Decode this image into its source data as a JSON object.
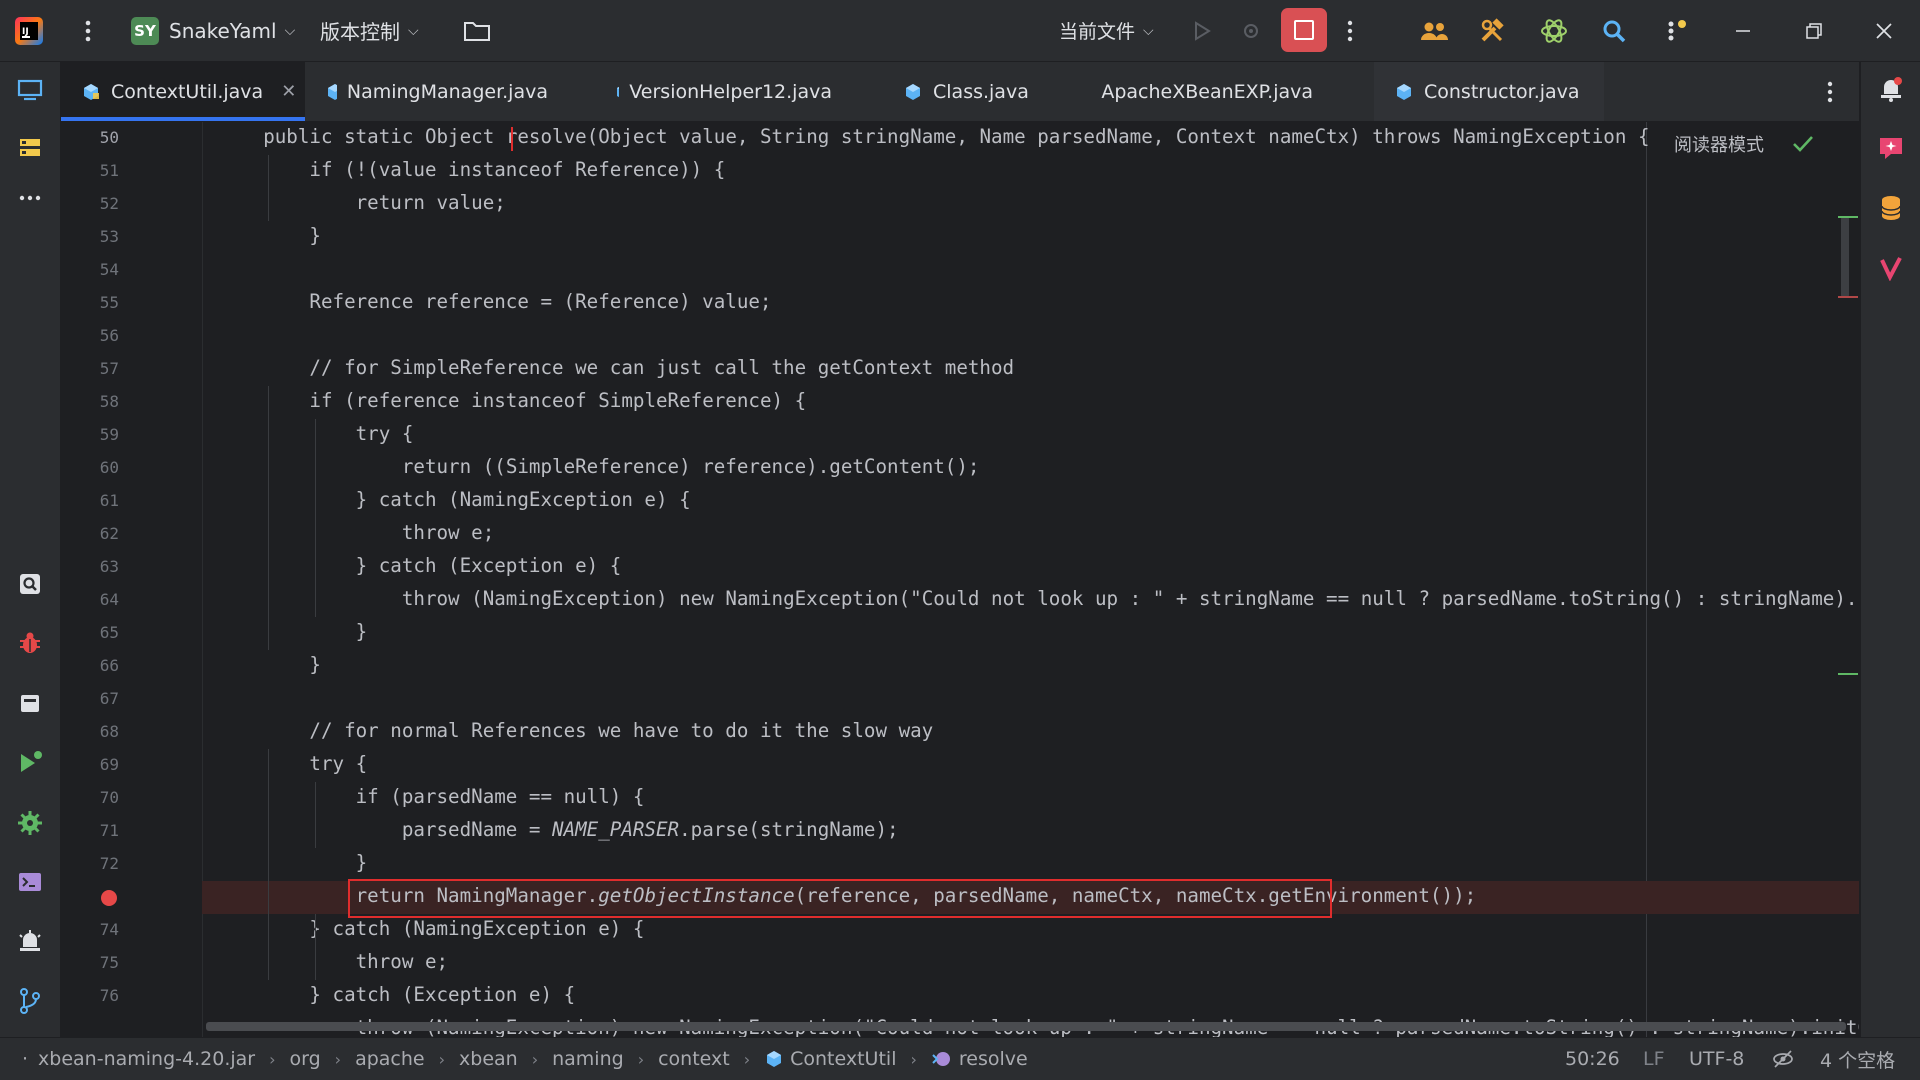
{
  "toolbar": {
    "project_initials": "SY",
    "project_name": "SnakeYaml",
    "vcs_label": "版本控制",
    "run_config": "当前文件"
  },
  "tabs": [
    {
      "label": "ContextUtil.java",
      "active": true,
      "icon": "java-class-icon"
    },
    {
      "label": "NamingManager.java",
      "active": false,
      "icon": "java-class-icon"
    },
    {
      "label": "VersionHelper12.java",
      "active": false,
      "icon": "java-class-icon"
    },
    {
      "label": "Class.java",
      "active": false,
      "icon": "java-class-icon"
    },
    {
      "label": "ApacheXBeanEXP.java",
      "active": false,
      "icon": "java-class-icon"
    },
    {
      "label": "Constructor.java",
      "active": false,
      "icon": "java-class-icon"
    }
  ],
  "editor": {
    "reader_mode_label": "阅读器模式",
    "line_numbers": [
      "50",
      "51",
      "52",
      "53",
      "54",
      "55",
      "56",
      "57",
      "58",
      "59",
      "60",
      "61",
      "62",
      "63",
      "64",
      "65",
      "66",
      "67",
      "68",
      "69",
      "70",
      "71",
      "72",
      "",
      "74",
      "75",
      "76"
    ],
    "breakpoint_line": "73",
    "lines": [
      [
        [
          "    public ",
          "kw"
        ],
        [
          "static ",
          "kw"
        ],
        [
          "Object ",
          ""
        ],
        [
          "resolve",
          "fn"
        ],
        [
          "(Object value, String stringName, Name parsedName, Context nameCtx) ",
          ""
        ],
        [
          "throws ",
          "kw"
        ],
        [
          "NamingException {",
          ""
        ]
      ],
      [
        [
          "        ",
          ""
        ],
        [
          "if ",
          "kw"
        ],
        [
          "(!(value ",
          ""
        ],
        [
          "instanceof ",
          "kw"
        ],
        [
          "Reference)) {",
          ""
        ]
      ],
      [
        [
          "            ",
          ""
        ],
        [
          "return ",
          "kw"
        ],
        [
          "value;",
          ""
        ]
      ],
      [
        [
          "        }",
          ""
        ]
      ],
      [
        [
          "",
          ""
        ]
      ],
      [
        [
          "        Reference reference = (Reference) value;",
          ""
        ]
      ],
      [
        [
          "",
          ""
        ]
      ],
      [
        [
          "        ",
          ""
        ],
        [
          "// for SimpleReference we can just call the getContext method",
          "cm"
        ]
      ],
      [
        [
          "        ",
          ""
        ],
        [
          "if ",
          "kw"
        ],
        [
          "(reference ",
          ""
        ],
        [
          "instanceof ",
          "kw"
        ],
        [
          "SimpleReference) {",
          ""
        ]
      ],
      [
        [
          "            ",
          ""
        ],
        [
          "try ",
          "kw"
        ],
        [
          "{",
          ""
        ]
      ],
      [
        [
          "                ",
          ""
        ],
        [
          "return ",
          "kw"
        ],
        [
          "((SimpleReference) reference).getContent();",
          ""
        ]
      ],
      [
        [
          "            } ",
          ""
        ],
        [
          "catch ",
          "kw"
        ],
        [
          "(NamingException e) {",
          ""
        ]
      ],
      [
        [
          "                ",
          ""
        ],
        [
          "throw ",
          "kw"
        ],
        [
          "e;",
          ""
        ]
      ],
      [
        [
          "            } ",
          ""
        ],
        [
          "catch ",
          "kw"
        ],
        [
          "(Exception e) {",
          ""
        ]
      ],
      [
        [
          "                ",
          ""
        ],
        [
          "throw ",
          "kw"
        ],
        [
          "(NamingException) ",
          ""
        ],
        [
          "new ",
          "kw"
        ],
        [
          "NamingException(",
          ""
        ],
        [
          "\"Could not look up : \" ",
          "str"
        ],
        [
          "+ stringName == ",
          ""
        ],
        [
          "null ",
          "kw"
        ],
        [
          "? parsedName.toString() : stringName).initCause(e);",
          ""
        ]
      ],
      [
        [
          "            }",
          ""
        ]
      ],
      [
        [
          "        }",
          ""
        ]
      ],
      [
        [
          "",
          ""
        ]
      ],
      [
        [
          "        ",
          ""
        ],
        [
          "// for normal References we have to do it the slow way",
          "cm"
        ]
      ],
      [
        [
          "        ",
          ""
        ],
        [
          "try ",
          "kw"
        ],
        [
          "{",
          ""
        ]
      ],
      [
        [
          "            ",
          ""
        ],
        [
          "if ",
          "kw"
        ],
        [
          "(parsedName == ",
          ""
        ],
        [
          "null",
          "kw"
        ],
        [
          ") {",
          ""
        ]
      ],
      [
        [
          "                parsedName = ",
          ""
        ],
        [
          "NAME_PARSER",
          "const"
        ],
        [
          ".parse(stringName);",
          ""
        ]
      ],
      [
        [
          "            }",
          ""
        ]
      ],
      [
        [
          "            ",
          ""
        ],
        [
          "return ",
          "kw"
        ],
        [
          "NamingManager.",
          ""
        ],
        [
          "getObjectInstance",
          "it"
        ],
        [
          "(reference, parsedName, nameCtx, nameCtx.getEnvironment());",
          ""
        ]
      ],
      [
        [
          "        } ",
          ""
        ],
        [
          "catch ",
          "kw"
        ],
        [
          "(NamingException e) {",
          ""
        ]
      ],
      [
        [
          "            ",
          ""
        ],
        [
          "throw ",
          "kw"
        ],
        [
          "e;",
          ""
        ]
      ],
      [
        [
          "        } ",
          ""
        ],
        [
          "catch ",
          "kw"
        ],
        [
          "(Exception e) {",
          ""
        ]
      ],
      [
        [
          "            ",
          ""
        ],
        [
          "throw ",
          "kw"
        ],
        [
          "(NamingException) ",
          ""
        ],
        [
          "new ",
          "kw"
        ],
        [
          "NamingException(",
          ""
        ],
        [
          "\"Could not look up : \" ",
          "str"
        ],
        [
          "+ stringName == ",
          ""
        ],
        [
          "null ",
          "kw"
        ],
        [
          "? parsedName.toString() : stringName).initCause(e);",
          ""
        ]
      ]
    ]
  },
  "breadcrumbs": [
    "xbean-naming-4.20.jar",
    "org",
    "apache",
    "xbean",
    "naming",
    "context",
    "ContextUtil",
    "resolve"
  ],
  "status": {
    "position": "50:26",
    "line_ending": "LF",
    "encoding": "UTF-8",
    "indent": "4 个空格"
  },
  "colors": {
    "accent": "#3574f0",
    "breakpoint": "#e64848",
    "stop_button": "#d95054",
    "highlight_box": "#e02d2d"
  }
}
